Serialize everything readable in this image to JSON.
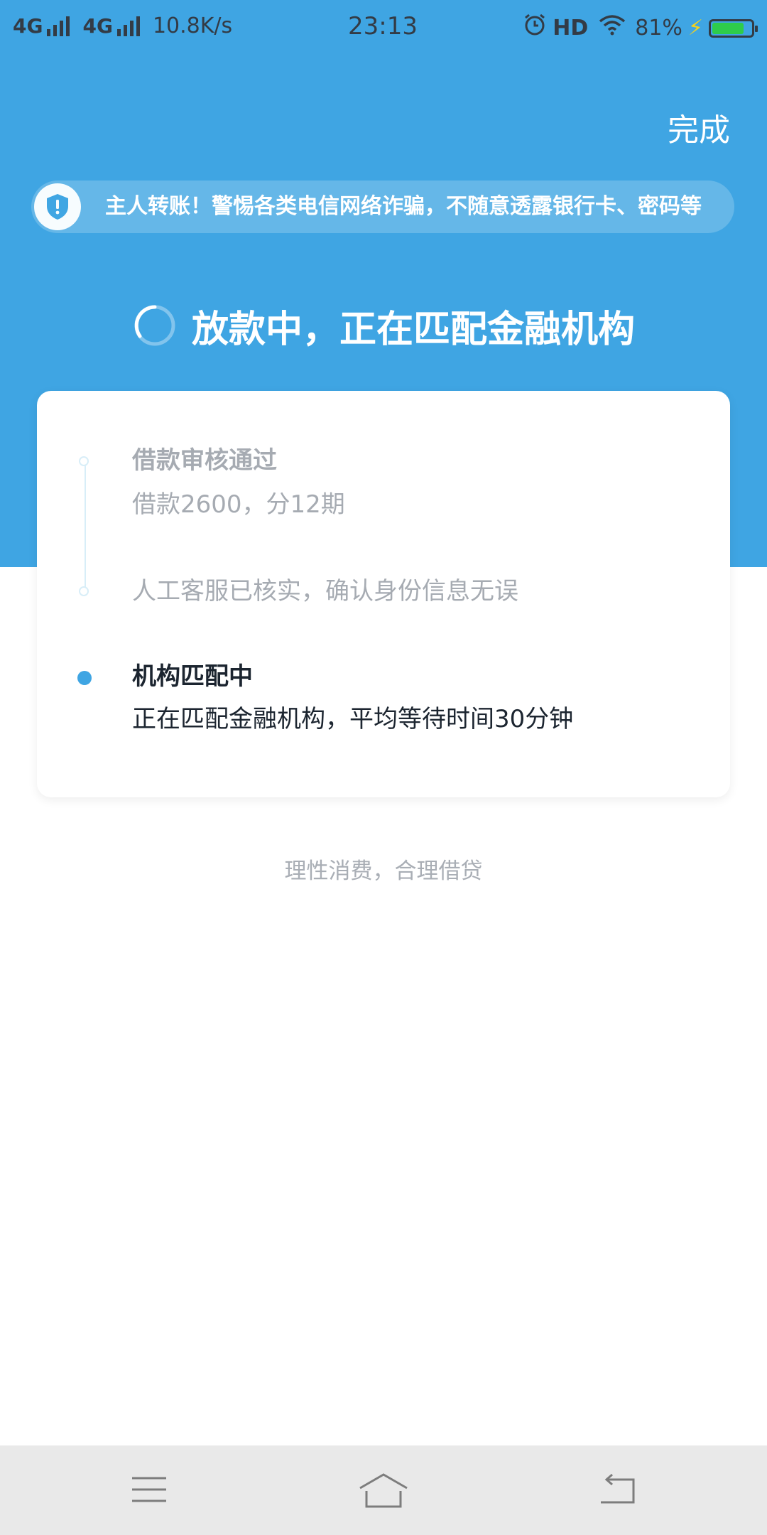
{
  "status_bar": {
    "net1": "4G",
    "net2": "4G",
    "speed": "10.8K/s",
    "time": "23:13",
    "hd": "HD",
    "battery_pct": "81%",
    "battery_level": 0.81
  },
  "header": {
    "done_label": "完成"
  },
  "notice": {
    "text": "主人转账！警惕各类电信网络诈骗，不随意透露银行卡、密码等"
  },
  "title": {
    "text": "放款中，正在匹配金融机构"
  },
  "steps": [
    {
      "title": "借款审核通过",
      "desc": "借款2600，分12期"
    },
    {
      "title": "人工客服已核实，确认身份信息无误"
    },
    {
      "title": "机构匹配中",
      "desc": "正在匹配金融机构，平均等待时间30分钟"
    }
  ],
  "footer_note": "理性消费，合理借贷",
  "colors": {
    "primary": "#3FA5E3",
    "active_text": "#1c2530",
    "muted_text": "#a6abb2"
  }
}
